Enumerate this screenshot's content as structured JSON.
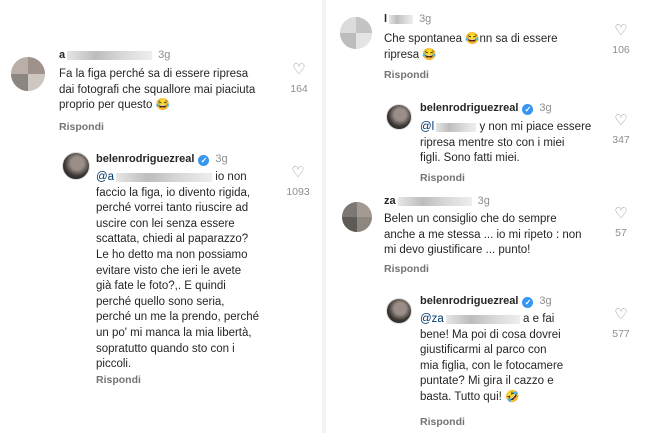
{
  "left": {
    "c1": {
      "username": "a",
      "time": "3g",
      "lines": [
        "Fa la figa perché sa di essere ripresa",
        "dai fotografi che squallore mai piaciuta",
        "proprio per questo 😂"
      ],
      "reply": "Rispondi",
      "likes": "164"
    },
    "c2": {
      "username": "belenrodriguezreal",
      "time": "3g",
      "mention": "@a",
      "first_rest": "io non",
      "lines": [
        "faccio la figa, io divento rigida,",
        "perché vorrei tanto riuscire ad",
        "uscire con lei senza essere",
        "scattata, chiedi al paparazzo?",
        "Le ho detto ma non possiamo",
        "evitare visto che ieri le avete",
        "già fate le foto?,. E quindi",
        "perché quello sono seria,",
        "perché un me la prendo, perché",
        "un po' mi manca la mia libertà,",
        "sopratutto quando sto con i",
        "piccoli."
      ],
      "reply": "Rispondi",
      "likes": "1093"
    }
  },
  "right": {
    "c3": {
      "username": "l",
      "time": "3g",
      "lines": [
        "Che spontanea 😂nn sa di essere",
        "ripresa 😂"
      ],
      "reply": "Rispondi",
      "likes": "106"
    },
    "c4": {
      "username": "belenrodriguezreal",
      "time": "3g",
      "mention": "@l",
      "first_rest": "y non mi piace essere",
      "lines": [
        "ripresa mentre sto con i miei",
        "figli. Sono fatti miei."
      ],
      "reply": "Rispondi",
      "likes": "347"
    },
    "c5": {
      "username": "za",
      "time": "3g",
      "lines": [
        "Belen un consiglio che do sempre",
        "anche a me stessa ... io mi ripeto : non",
        "mi devo giustificare ... punto!"
      ],
      "reply": "Rispondi",
      "likes": "57"
    },
    "c6": {
      "username": "belenrodriguezreal",
      "time": "3g",
      "mention": "@za",
      "first_rest": "a e fai",
      "lines": [
        "bene! Ma poi di cosa dovrei",
        "giustificarmi al parco con",
        "mia figlia, con le fotocamere",
        "puntate? Mi gira il cazzo e",
        "basta. Tutto qui! 🤣"
      ],
      "reply": "Rispondi",
      "likes": "577"
    }
  },
  "icons": {
    "like": "heart-outline-icon",
    "verified": "verified-badge-icon"
  },
  "colors": {
    "verified": "#3797f0",
    "mention": "#00376b",
    "muted": "#8e8e8e"
  }
}
